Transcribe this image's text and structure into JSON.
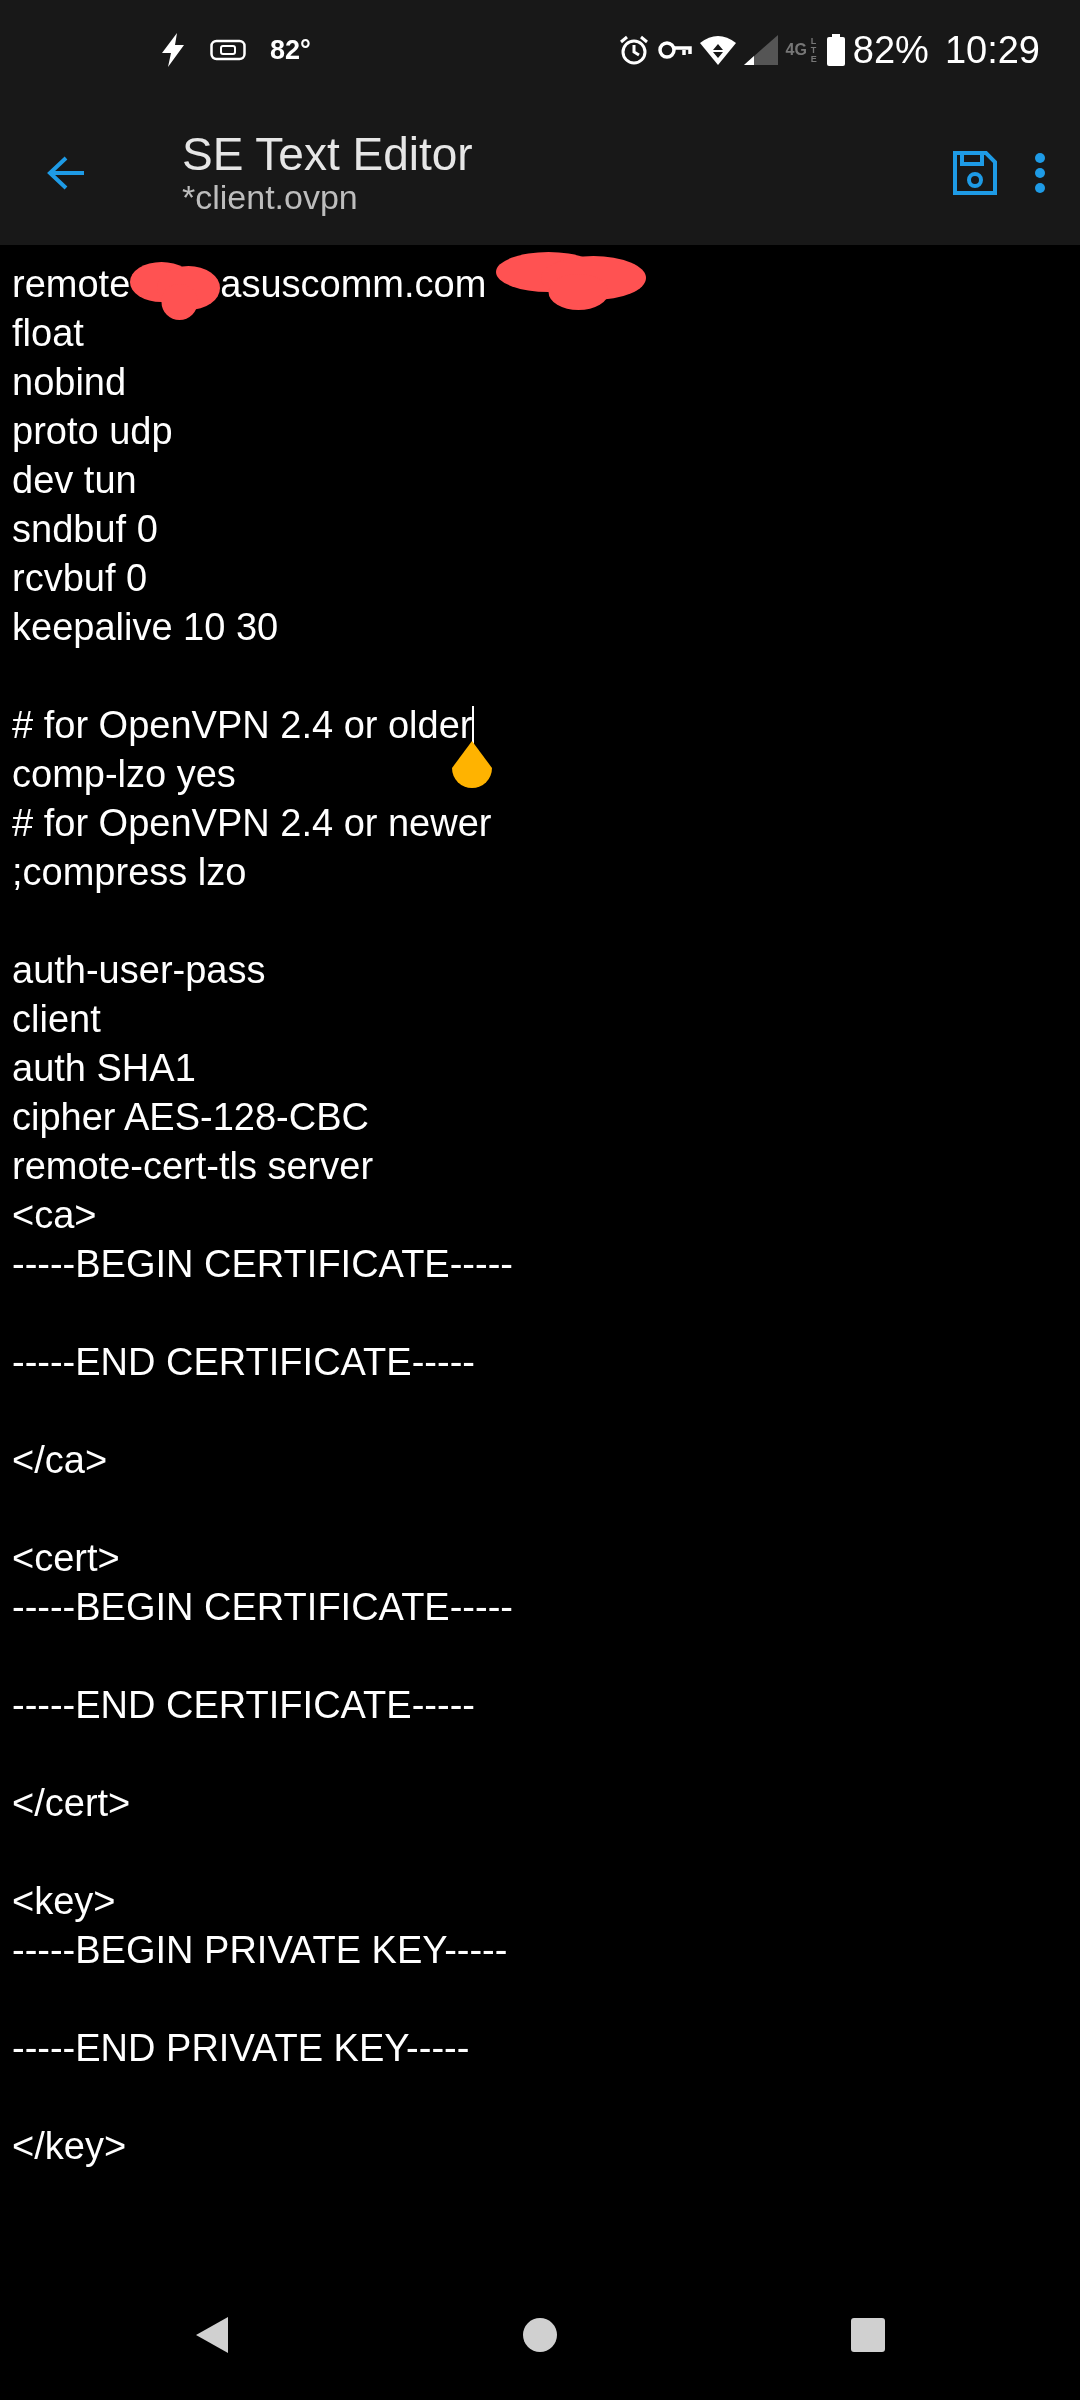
{
  "status_bar": {
    "temperature": "82°",
    "network": "4G",
    "network_sub": "LTE",
    "battery": "82%",
    "time": "10:29"
  },
  "toolbar": {
    "title": "SE Text Editor",
    "subtitle": "*client.ovpn"
  },
  "editor": {
    "lines": [
      {
        "kind": "redacted",
        "parts": [
          "remote",
          "asuscomm.com"
        ]
      },
      {
        "kind": "text",
        "text": "float",
        "cursor": false
      },
      {
        "kind": "text",
        "text": "nobind",
        "cursor": false
      },
      {
        "kind": "text",
        "text": "proto udp",
        "cursor": false
      },
      {
        "kind": "text",
        "text": "dev tun",
        "cursor": false
      },
      {
        "kind": "text",
        "text": "sndbuf 0",
        "cursor": false
      },
      {
        "kind": "text",
        "text": "rcvbuf 0",
        "cursor": false
      },
      {
        "kind": "text",
        "text": "keepalive 10 30",
        "cursor": false
      },
      {
        "kind": "blank"
      },
      {
        "kind": "text",
        "text": "# for OpenVPN 2.4 or older",
        "cursor": true
      },
      {
        "kind": "text",
        "text": "comp-lzo yes",
        "cursor": false
      },
      {
        "kind": "text",
        "text": "# for OpenVPN 2.4 or newer",
        "cursor": false
      },
      {
        "kind": "text",
        "text": ";compress lzo",
        "cursor": false
      },
      {
        "kind": "blank"
      },
      {
        "kind": "text",
        "text": "auth-user-pass",
        "cursor": false
      },
      {
        "kind": "text",
        "text": "client",
        "cursor": false
      },
      {
        "kind": "text",
        "text": "auth SHA1",
        "cursor": false
      },
      {
        "kind": "text",
        "text": "cipher AES-128-CBC",
        "cursor": false
      },
      {
        "kind": "text",
        "text": "remote-cert-tls server",
        "cursor": false
      },
      {
        "kind": "text",
        "text": "<ca>",
        "cursor": false
      },
      {
        "kind": "text",
        "text": "-----BEGIN CERTIFICATE-----",
        "cursor": false
      },
      {
        "kind": "blank"
      },
      {
        "kind": "text",
        "text": "-----END CERTIFICATE-----",
        "cursor": false
      },
      {
        "kind": "blank"
      },
      {
        "kind": "text",
        "text": "</ca>",
        "cursor": false
      },
      {
        "kind": "blank"
      },
      {
        "kind": "text",
        "text": "<cert>",
        "cursor": false
      },
      {
        "kind": "text",
        "text": "-----BEGIN CERTIFICATE-----",
        "cursor": false
      },
      {
        "kind": "blank"
      },
      {
        "kind": "text",
        "text": "-----END CERTIFICATE-----",
        "cursor": false
      },
      {
        "kind": "blank"
      },
      {
        "kind": "text",
        "text": "</cert>",
        "cursor": false
      },
      {
        "kind": "blank"
      },
      {
        "kind": "text",
        "text": "<key>",
        "cursor": false
      },
      {
        "kind": "text",
        "text": "-----BEGIN PRIVATE KEY-----",
        "cursor": false
      },
      {
        "kind": "blank"
      },
      {
        "kind": "text",
        "text": "-----END PRIVATE KEY-----",
        "cursor": false
      },
      {
        "kind": "blank"
      },
      {
        "kind": "text",
        "text": "</key>",
        "cursor": false
      }
    ]
  }
}
